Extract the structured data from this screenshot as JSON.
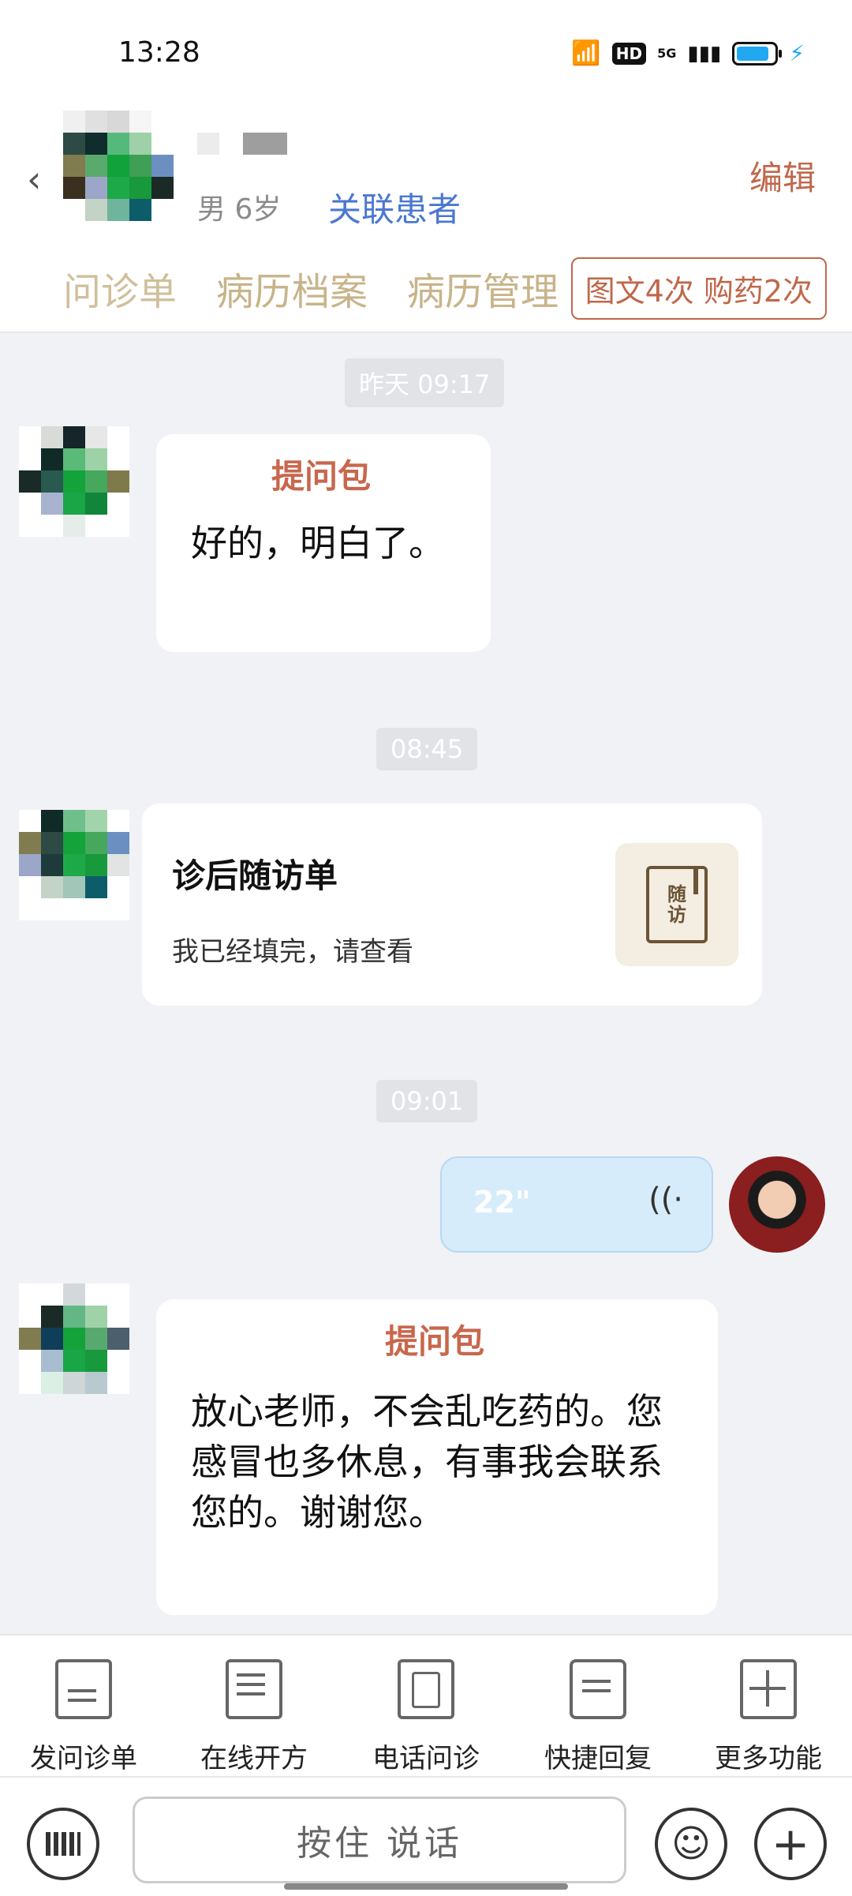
{
  "status_bar": {
    "time": "13:28",
    "hd": "HD",
    "network": "5G"
  },
  "header": {
    "patient_meta": "男 6岁",
    "link_patient": "关联患者",
    "edit": "编辑",
    "tabs": [
      "问诊单",
      "病历档案",
      "病历管理"
    ],
    "quota": "图文4次 购药2次"
  },
  "chat": {
    "t1": "昨天 09:17",
    "m1_tag": "提问包",
    "m1_text": "好的，明白了。",
    "t2": "08:45",
    "followup_title": "诊后随访单",
    "followup_sub": "我已经填完，请查看",
    "followup_icon_line1": "随",
    "followup_icon_line2": "访",
    "t3": "09:01",
    "voice_len": "22\"",
    "m3_tag": "提问包",
    "m3_text_1": "放心老师，不会乱吃药的。您",
    "m3_text_2": "感冒也多休息，有事我会联系",
    "m3_text_3": "您的。谢谢您。"
  },
  "toolbar": {
    "items": [
      "发问诊单",
      "在线开方",
      "电话问诊",
      "快捷回复",
      "更多功能"
    ]
  },
  "input": {
    "hold_talk": "按住 说话"
  }
}
